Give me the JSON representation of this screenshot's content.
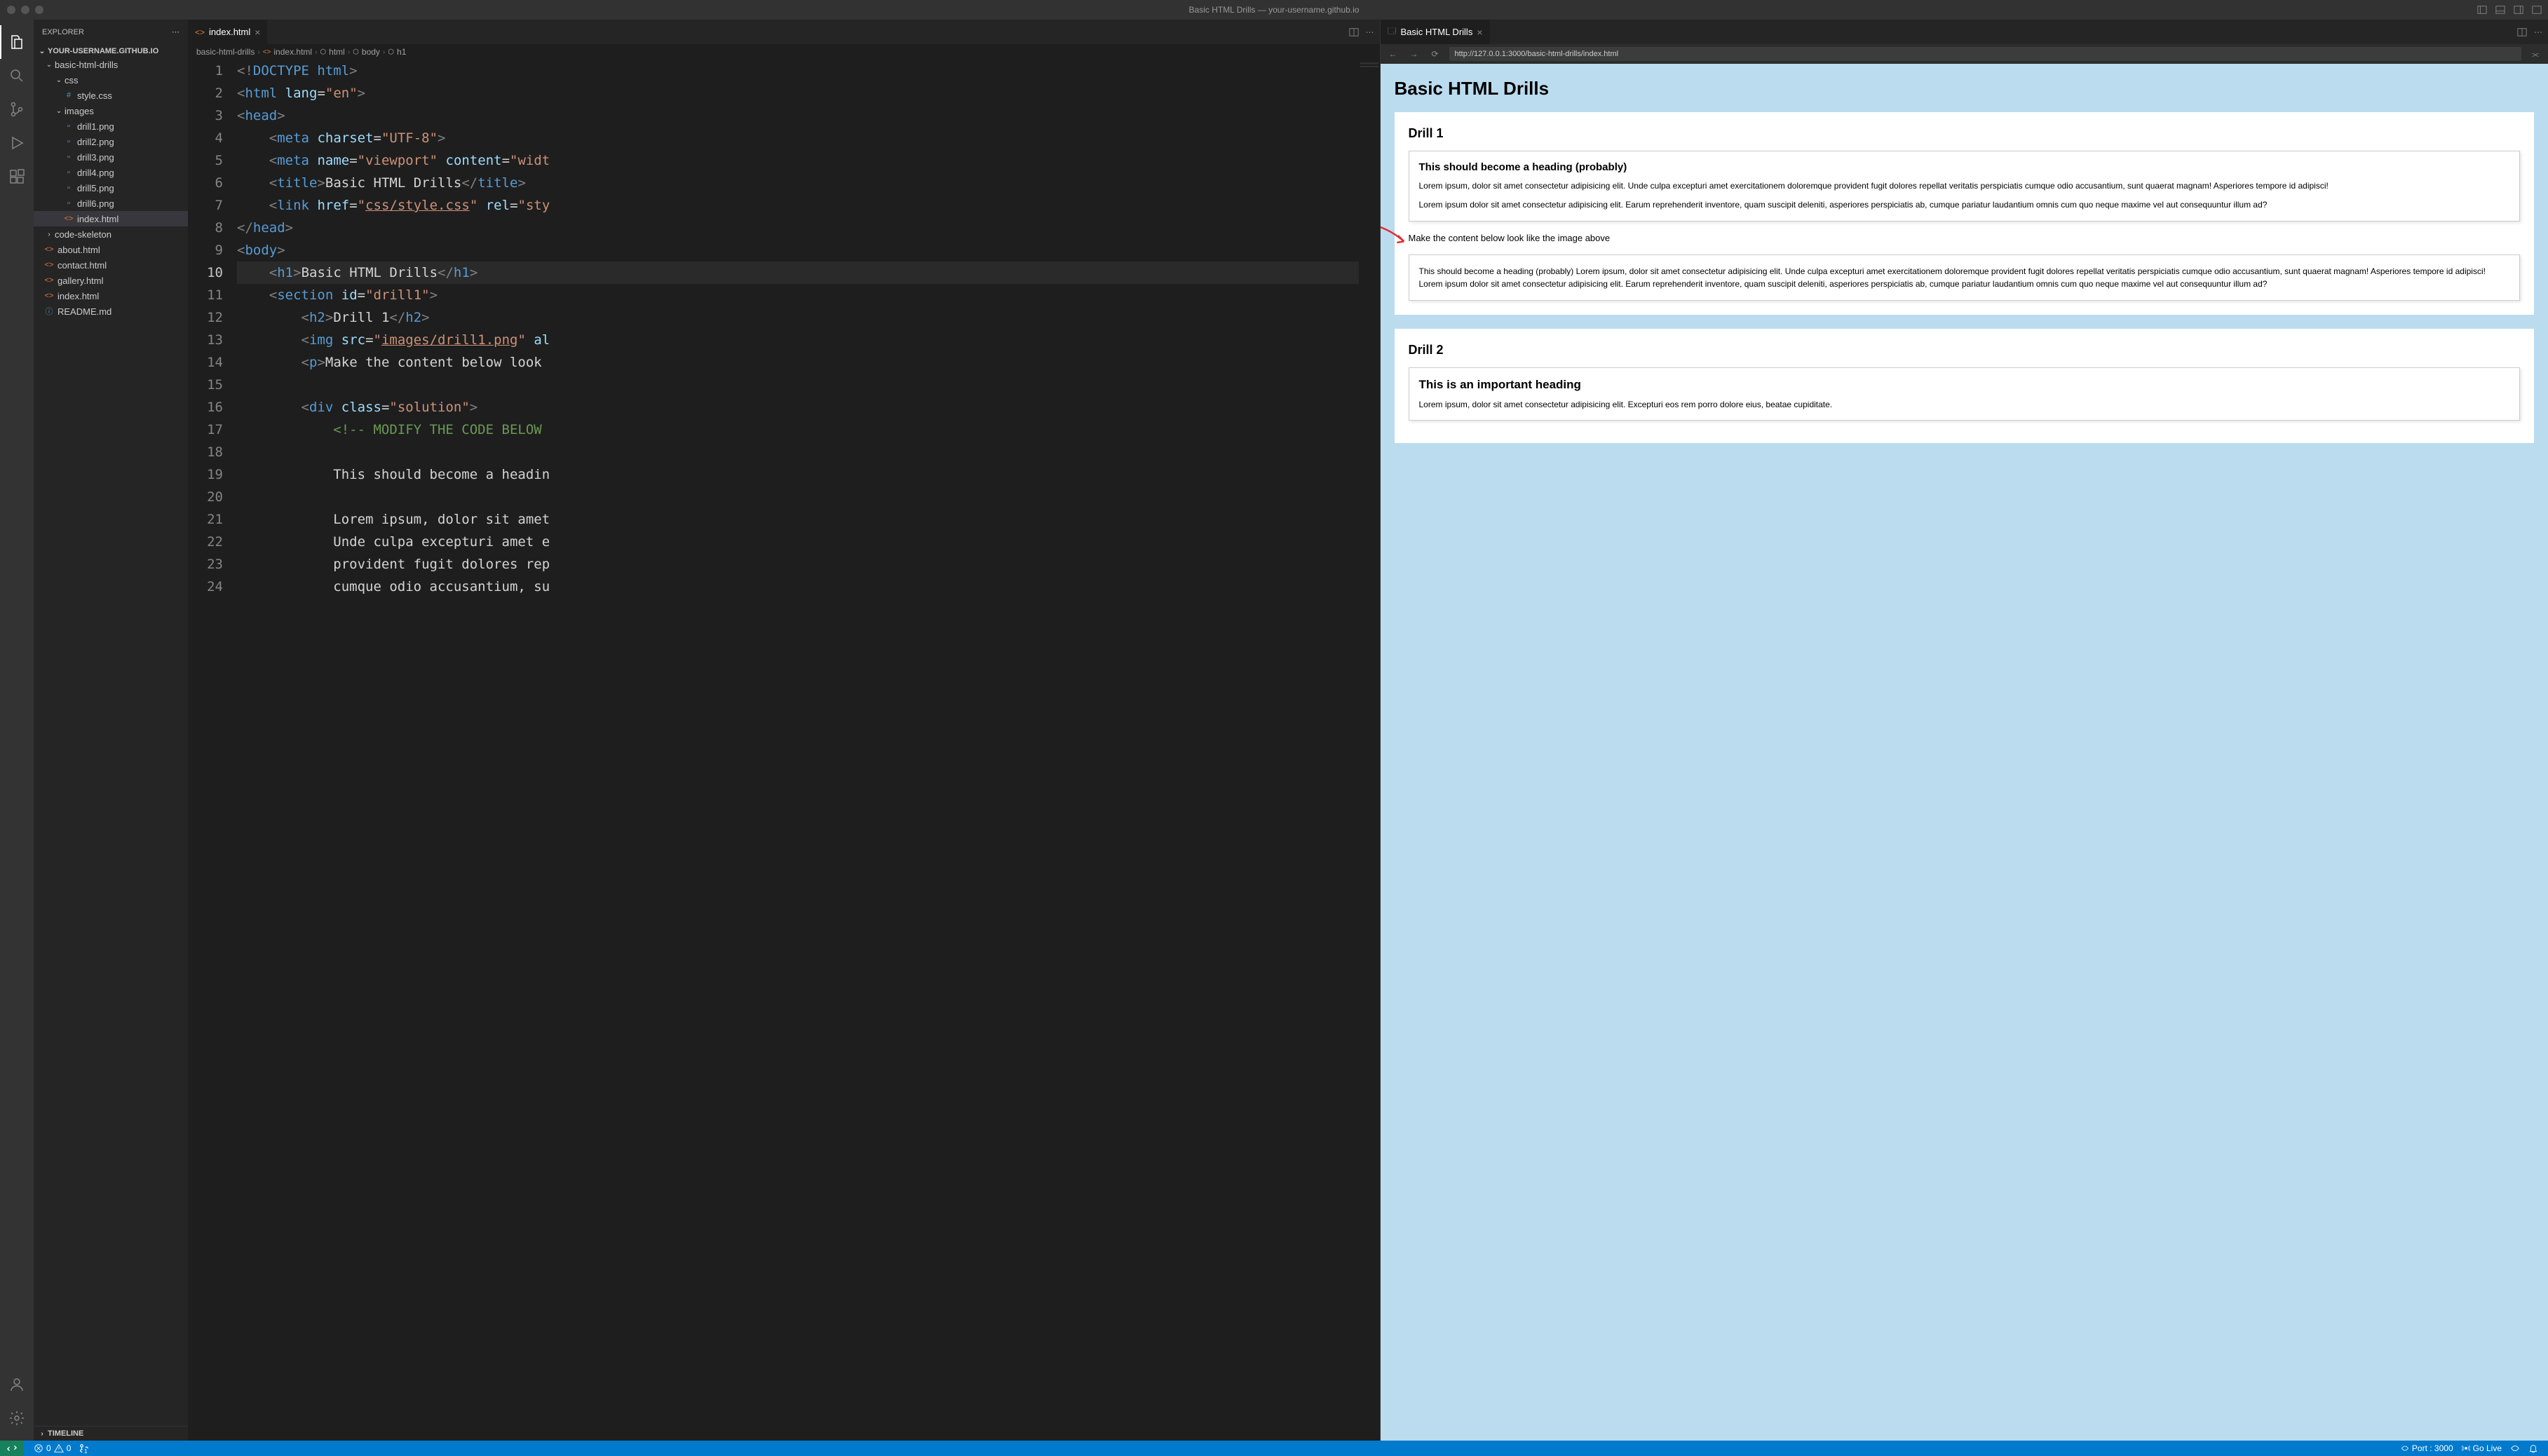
{
  "titlebar": {
    "title": "Basic HTML Drills — your-username.github.io"
  },
  "sidebar": {
    "header": "EXPLORER",
    "project": "YOUR-USERNAME.GITHUB.IO",
    "tree": [
      {
        "label": "basic-html-drills",
        "type": "folder",
        "indent": 1,
        "open": true
      },
      {
        "label": "css",
        "type": "folder",
        "indent": 2,
        "open": true
      },
      {
        "label": "style.css",
        "type": "file",
        "indent": 3,
        "icon": "#"
      },
      {
        "label": "images",
        "type": "folder",
        "indent": 2,
        "open": true
      },
      {
        "label": "drill1.png",
        "type": "file",
        "indent": 3,
        "icon": "▫"
      },
      {
        "label": "drill2.png",
        "type": "file",
        "indent": 3,
        "icon": "▫"
      },
      {
        "label": "drill3.png",
        "type": "file",
        "indent": 3,
        "icon": "▫"
      },
      {
        "label": "drill4.png",
        "type": "file",
        "indent": 3,
        "icon": "▫"
      },
      {
        "label": "drill5.png",
        "type": "file",
        "indent": 3,
        "icon": "▫"
      },
      {
        "label": "drill6.png",
        "type": "file",
        "indent": 3,
        "icon": "▫"
      },
      {
        "label": "index.html",
        "type": "file",
        "indent": 3,
        "icon": "<>",
        "selected": true
      },
      {
        "label": "code-skeleton",
        "type": "folder",
        "indent": 1,
        "open": false
      },
      {
        "label": "about.html",
        "type": "file",
        "indent": 1,
        "icon": "<>"
      },
      {
        "label": "contact.html",
        "type": "file",
        "indent": 1,
        "icon": "<>"
      },
      {
        "label": "gallery.html",
        "type": "file",
        "indent": 1,
        "icon": "<>"
      },
      {
        "label": "index.html",
        "type": "file",
        "indent": 1,
        "icon": "<>"
      },
      {
        "label": "README.md",
        "type": "file",
        "indent": 1,
        "icon": "ⓘ"
      }
    ],
    "timeline": "TIMELINE"
  },
  "editor": {
    "tab": "index.html",
    "breadcrumbs": [
      "basic-html-drills",
      "index.html",
      "html",
      "body",
      "h1"
    ],
    "previewTab": "Basic HTML Drills",
    "url": "http://127.0.0.1:3000/basic-html-drills/index.html",
    "lines": [
      1,
      2,
      3,
      4,
      5,
      6,
      7,
      8,
      9,
      10,
      11,
      12,
      13,
      14,
      15,
      16,
      17,
      18,
      19,
      20,
      21,
      22,
      23,
      24
    ],
    "currentLine": 10,
    "code": {
      "l1": {
        "doctype": "<!DOCTYPE ",
        "html": "html",
        "close": ">"
      },
      "l2": {
        "open": "<",
        "tag": "html",
        "sp": " ",
        "attr": "lang",
        "eq": "=",
        "val": "\"en\"",
        "close": ">"
      },
      "l3": {
        "open": "<",
        "tag": "head",
        "close": ">"
      },
      "l4": {
        "indent": "    ",
        "open": "<",
        "tag": "meta",
        "sp": " ",
        "attr": "charset",
        "eq": "=",
        "val": "\"UTF-8\"",
        "close": ">"
      },
      "l5": {
        "indent": "    ",
        "open": "<",
        "tag": "meta",
        "sp": " ",
        "attr1": "name",
        "eq1": "=",
        "val1": "\"viewport\"",
        "sp2": " ",
        "attr2": "content",
        "eq2": "=",
        "val2": "\"widt"
      },
      "l6": {
        "indent": "    ",
        "open": "<",
        "tag": "title",
        "close": ">",
        "text": "Basic HTML Drills",
        "copen": "</",
        "ctag": "title",
        "cclose": ">"
      },
      "l7": {
        "indent": "    ",
        "open": "<",
        "tag": "link",
        "sp": " ",
        "attr1": "href",
        "eq1": "=",
        "val1a": "\"",
        "val1b": "css/style.css",
        "val1c": "\"",
        "sp2": " ",
        "attr2": "rel",
        "eq2": "=",
        "val2": "\"sty"
      },
      "l8": {
        "open": "</",
        "tag": "head",
        "close": ">"
      },
      "l9": {
        "open": "<",
        "tag": "body",
        "close": ">"
      },
      "l10": {
        "indent": "    ",
        "open": "<",
        "tag": "h1",
        "close": ">",
        "text": "Basic HTML Drills",
        "copen": "</",
        "ctag": "h1",
        "cclose": ">"
      },
      "l11": {
        "indent": "    ",
        "open": "<",
        "tag": "section",
        "sp": " ",
        "attr": "id",
        "eq": "=",
        "val": "\"drill1\"",
        "close": ">"
      },
      "l12": {
        "indent": "        ",
        "open": "<",
        "tag": "h2",
        "close": ">",
        "text": "Drill 1",
        "copen": "</",
        "ctag": "h2",
        "cclose": ">"
      },
      "l13": {
        "indent": "        ",
        "open": "<",
        "tag": "img",
        "sp": " ",
        "attr1": "src",
        "eq1": "=",
        "val1a": "\"",
        "val1b": "images/drill1.png",
        "val1c": "\"",
        "sp2": " ",
        "attr2": "al"
      },
      "l14": {
        "indent": "        ",
        "open": "<",
        "tag": "p",
        "close": ">",
        "text": "Make the content below look "
      },
      "l15": {
        "blank": ""
      },
      "l16": {
        "indent": "        ",
        "open": "<",
        "tag": "div",
        "sp": " ",
        "attr": "class",
        "eq": "=",
        "val": "\"solution\"",
        "close": ">"
      },
      "l17": {
        "indent": "            ",
        "comment": "<!-- MODIFY THE CODE BELOW "
      },
      "l18": {
        "blank": ""
      },
      "l19": {
        "indent": "            ",
        "text": "This should become a headin"
      },
      "l20": {
        "blank": ""
      },
      "l21": {
        "indent": "            ",
        "text": "Lorem ipsum, dolor sit amet "
      },
      "l22": {
        "indent": "            ",
        "text": "Unde culpa excepturi amet e"
      },
      "l23": {
        "indent": "            ",
        "text": "provident fugit dolores rep"
      },
      "l24": {
        "indent": "            ",
        "text": "cumque odio accusantium, su"
      }
    }
  },
  "preview": {
    "h1": "Basic HTML Drills",
    "drill1": {
      "title": "Drill 1",
      "boxHeading": "This should become a heading (probably)",
      "p1": "Lorem ipsum, dolor sit amet consectetur adipisicing elit. Unde culpa excepturi amet exercitationem doloremque provident fugit dolores repellat veritatis perspiciatis cumque odio accusantium, sunt quaerat magnam! Asperiores tempore id adipisci!",
      "p2": "Lorem ipsum dolor sit amet consectetur adipisicing elit. Earum reprehenderit inventore, quam suscipit deleniti, asperiores perspiciatis ab, cumque pariatur laudantium omnis cum quo neque maxime vel aut consequuntur illum ad?",
      "instruction": "Make the content below look like the image above",
      "solution": "This should become a heading (probably) Lorem ipsum, dolor sit amet consectetur adipisicing elit. Unde culpa excepturi amet exercitationem doloremque provident fugit dolores repellat veritatis perspiciatis cumque odio accusantium, sunt quaerat magnam! Asperiores tempore id adipisci! Lorem ipsum dolor sit amet consectetur adipisicing elit. Earum reprehenderit inventore, quam suscipit deleniti, asperiores perspiciatis ab, cumque pariatur laudantium omnis cum quo neque maxime vel aut consequuntur illum ad?"
    },
    "drill2": {
      "title": "Drill 2",
      "boxHeading": "This is an important heading",
      "p1": "Lorem ipsum, dolor sit amet consectetur adipisicing elit. Excepturi eos rem porro dolore eius, beatae cupiditate."
    }
  },
  "statusbar": {
    "errors": "0",
    "warnings": "0",
    "port": "Port : 3000",
    "golive": "Go Live"
  }
}
